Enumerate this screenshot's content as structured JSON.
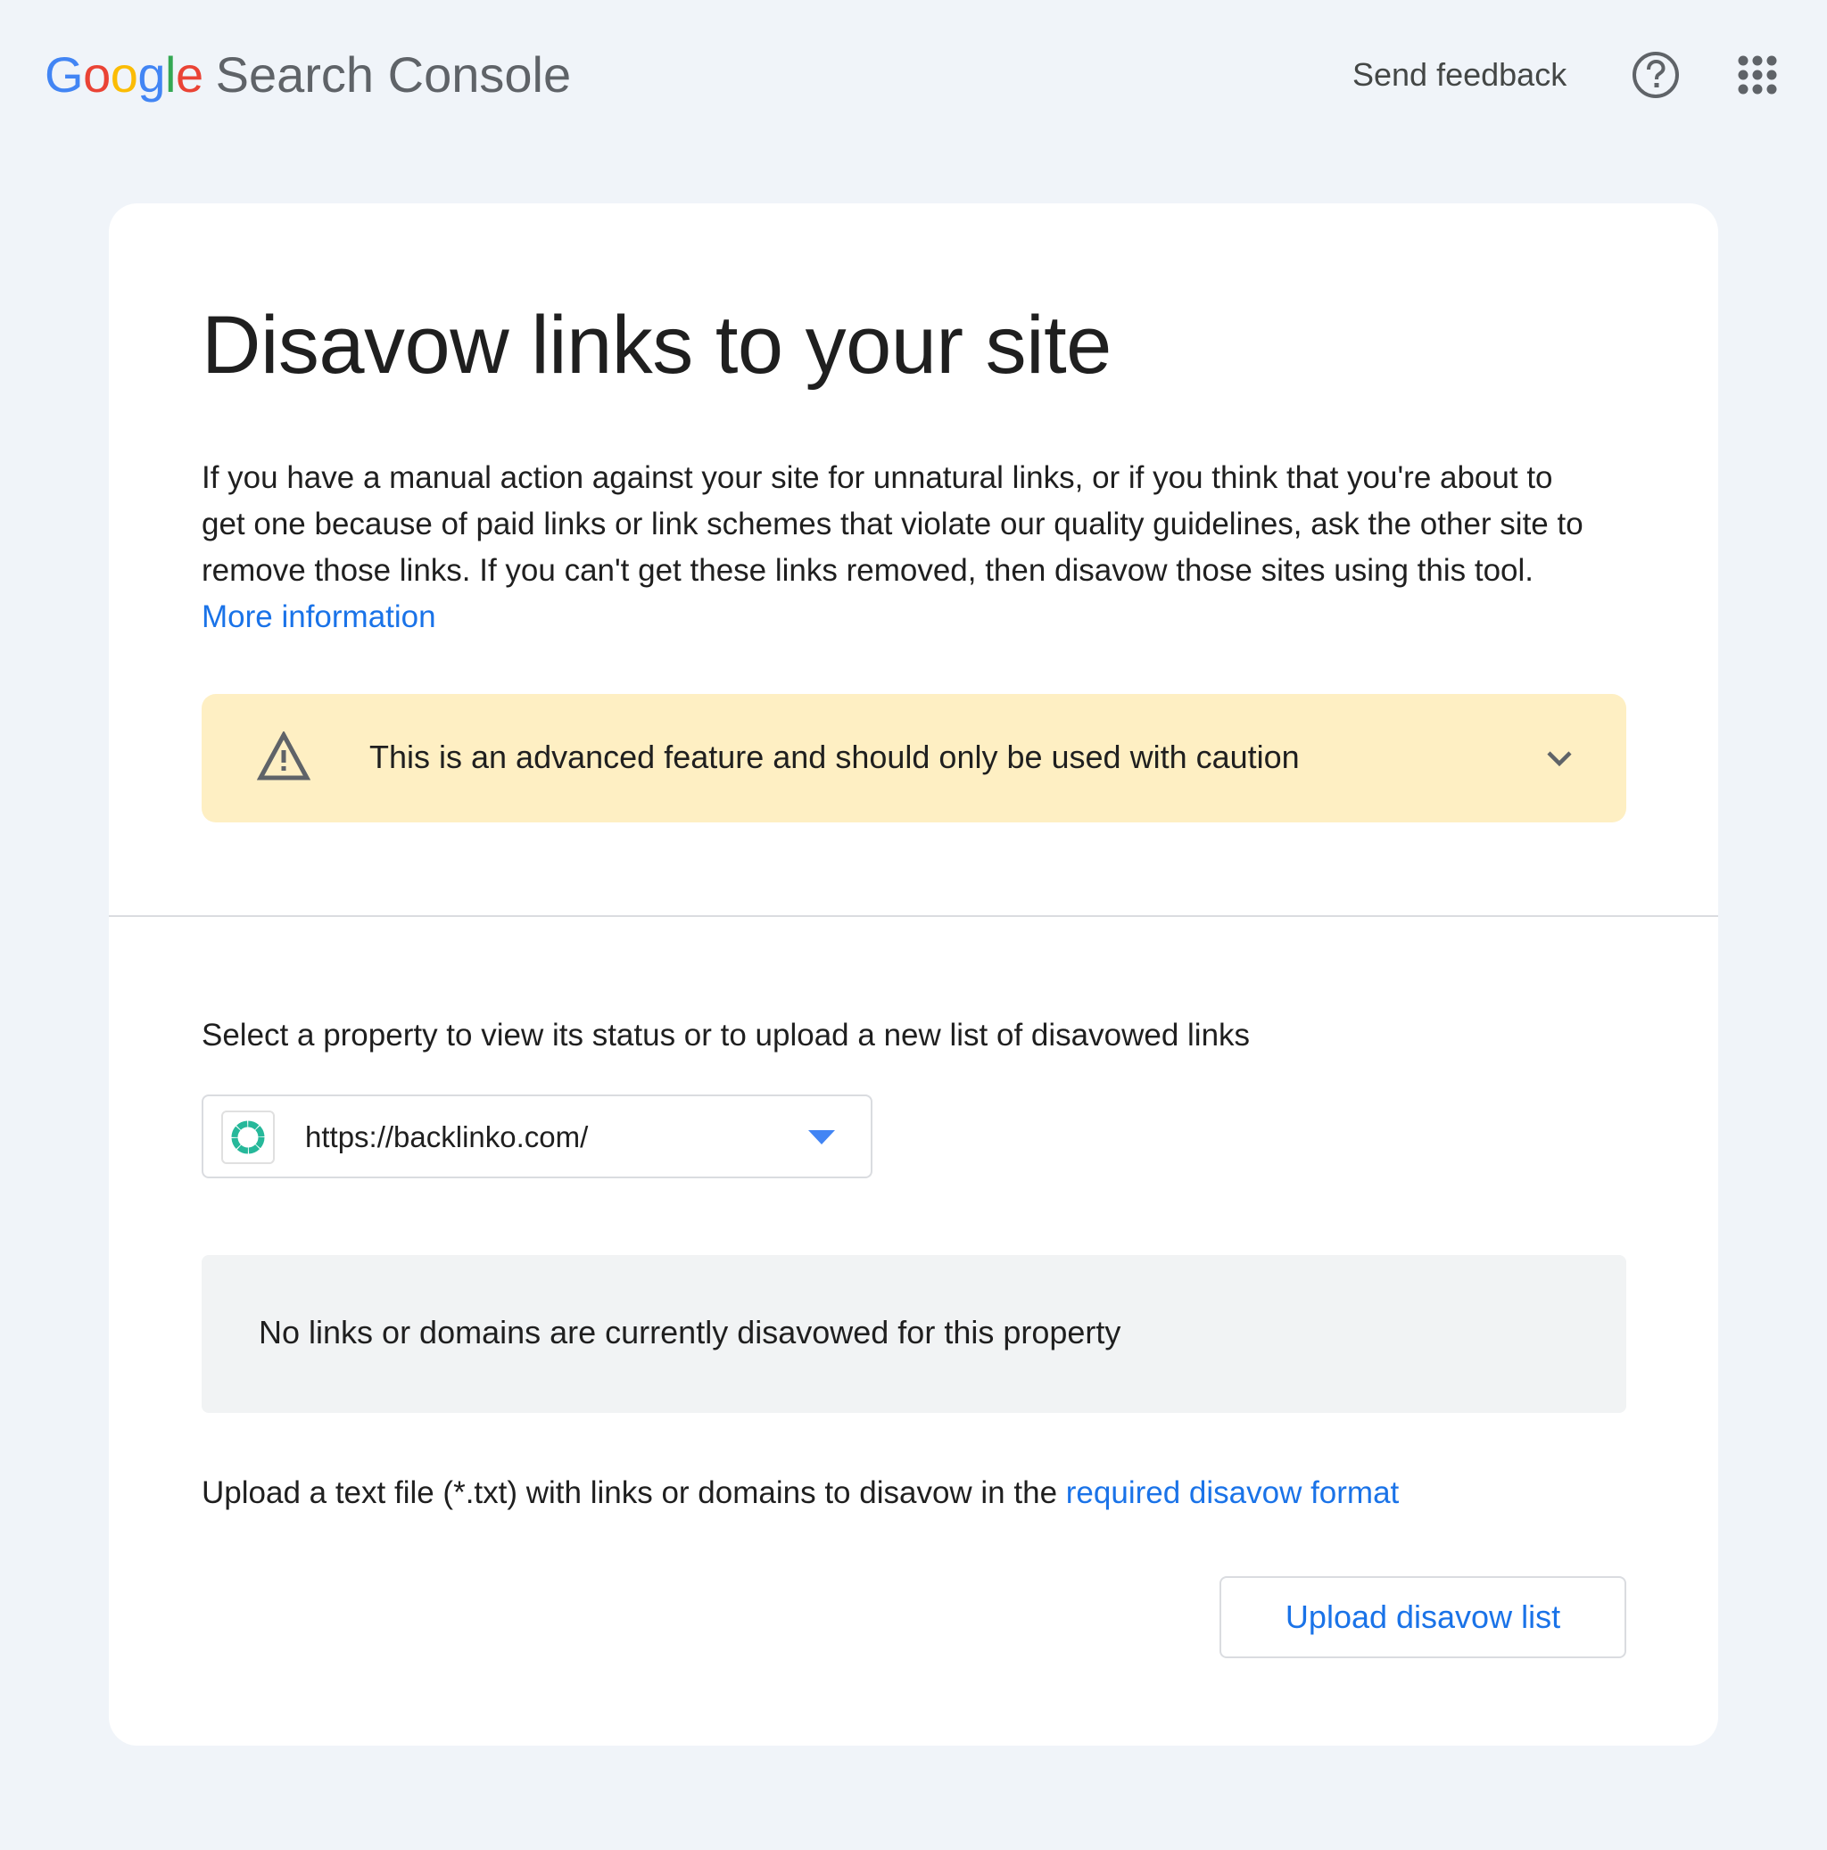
{
  "header": {
    "logo": {
      "google_letters": [
        {
          "char": "G",
          "color": "#4285f4"
        },
        {
          "char": "o",
          "color": "#ea4335"
        },
        {
          "char": "o",
          "color": "#fbbc04"
        },
        {
          "char": "g",
          "color": "#4285f4"
        },
        {
          "char": "l",
          "color": "#34a853"
        },
        {
          "char": "e",
          "color": "#ea4335"
        }
      ],
      "product_name": "Search Console"
    },
    "send_feedback_label": "Send feedback",
    "help_icon": "help-circle-icon",
    "apps_icon": "apps-grid-icon"
  },
  "main": {
    "title": "Disavow links to your site",
    "intro_text": "If you have a manual action against your site for unnatural links, or if you think that you're about to get one because of paid links or link schemes that violate our quality guidelines, ask the other site to remove those links. If you can't get these links removed, then disavow those sites using this tool.",
    "more_info_link": "More information",
    "warning": {
      "icon": "warning-triangle-icon",
      "text": "This is an advanced feature and should only be used with caution",
      "expand_icon": "chevron-down-icon",
      "background": "#feefc3"
    },
    "property_section": {
      "label": "Select a property to view its status or to upload a new list of disavowed links",
      "selected_property": "https://backlinko.com/",
      "favicon_color": "#26b89a",
      "dropdown_icon": "triangle-down-icon"
    },
    "status_message": "No links or domains are currently disavowed for this property",
    "upload": {
      "description": "Upload a text file (*.txt) with links or domains to disavow in the",
      "format_link": "required disavow format",
      "button_label": "Upload disavow list"
    }
  },
  "colors": {
    "page_background": "#f0f4f9",
    "card_background": "#ffffff",
    "link_blue": "#1a73e8",
    "icon_grey": "#5f6368",
    "dropdown_blue": "#4285f4"
  }
}
